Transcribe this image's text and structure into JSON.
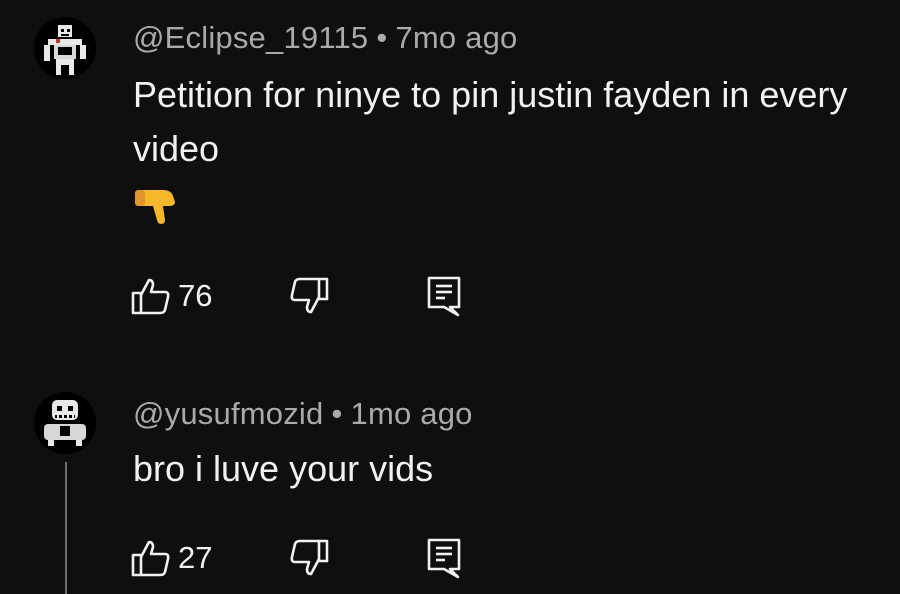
{
  "comments": [
    {
      "author": "@Eclipse_19115",
      "separator": "•",
      "time": "7mo ago",
      "text": "Petition for ninye to pin justin fayden in every video",
      "emoji": "👇",
      "likes": "76",
      "avatar_icon": "skeleton-character-avatar"
    },
    {
      "author": "@yusufmozid",
      "separator": "•",
      "time": "1mo ago",
      "text": "bro i luve your vids",
      "likes": "27",
      "avatar_icon": "skull-character-avatar"
    }
  ],
  "icons": {
    "like": "thumbs-up-icon",
    "dislike": "thumbs-down-icon",
    "reply": "reply-icon"
  },
  "colors": {
    "background": "#0f0f0f",
    "text": "#f1f1f1",
    "meta": "#aaaaaa"
  }
}
